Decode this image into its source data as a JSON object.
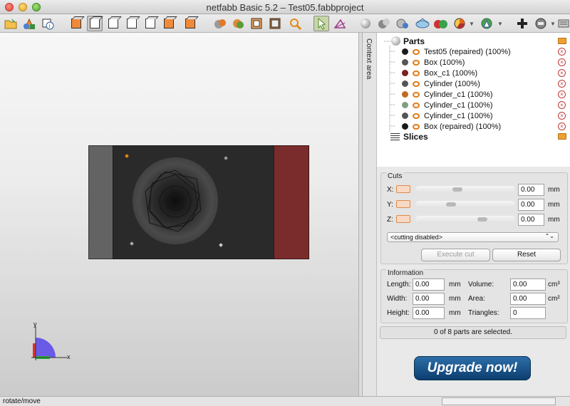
{
  "window": {
    "title": "netfabb Basic 5.2 – Test05.fabbproject"
  },
  "toolbar": {
    "icons": [
      "open-project-icon",
      "add-part-icon",
      "part-info-icon",
      "view-front-icon",
      "view-back-icon",
      "view-left-icon",
      "view-right-icon",
      "view-top-icon",
      "view-bottom-icon",
      "view-iso-icon",
      "shade-icon",
      "texture-icon",
      "frame-icon",
      "zoom-icon",
      "select-arrow-icon",
      "rotate-icon",
      "sphere-gray-icon",
      "sphere-dual-icon",
      "sphere-transparent-icon",
      "wireframe-icon",
      "color-spheres-icon",
      "pie-icon",
      "repair-icon",
      "add-icon",
      "settings-icon",
      "options-icon"
    ]
  },
  "viewport": {
    "axis_x": "x",
    "axis_y": "y"
  },
  "context_area": {
    "label": "Context area"
  },
  "tree": {
    "root": "Parts",
    "parts": [
      {
        "name": "Test05 (repaired) (100%)",
        "color": "#1a1a1a"
      },
      {
        "name": "Box (100%)",
        "color": "#555555"
      },
      {
        "name": "Box_c1 (100%)",
        "color": "#7a2020"
      },
      {
        "name": "Cylinder (100%)",
        "color": "#555555"
      },
      {
        "name": "Cylinder_c1 (100%)",
        "color": "#c06a20"
      },
      {
        "name": "Cylinder_c1 (100%)",
        "color": "#7fa080"
      },
      {
        "name": "Cylinder_c1 (100%)",
        "color": "#555555"
      },
      {
        "name": "Box (repaired) (100%)",
        "color": "#1a1a1a"
      }
    ],
    "slices": "Slices"
  },
  "cuts": {
    "title": "Cuts",
    "axes": [
      {
        "label": "X:",
        "value": "0.00",
        "unit": "mm",
        "knob_frac": 0.41
      },
      {
        "label": "Y:",
        "value": "0.00",
        "unit": "mm",
        "knob_frac": 0.34
      },
      {
        "label": "Z:",
        "value": "0.00",
        "unit": "mm",
        "knob_frac": 0.69
      }
    ],
    "mode": "<cutting disabled>",
    "execute": "Execute cut",
    "reset": "Reset"
  },
  "information": {
    "title": "Information",
    "length_label": "Length:",
    "length_value": "0.00",
    "length_unit": "mm",
    "width_label": "Width:",
    "width_value": "0.00",
    "width_unit": "mm",
    "height_label": "Height:",
    "height_value": "0.00",
    "height_unit": "mm",
    "volume_label": "Volume:",
    "volume_value": "0.00",
    "volume_unit": "cm³",
    "area_label": "Area:",
    "area_value": "0.00",
    "area_unit": "cm²",
    "triangles_label": "Triangles:",
    "triangles_value": "0"
  },
  "selection_status": "0 of 8 parts are selected.",
  "upgrade": "Upgrade now!",
  "statusbar": {
    "mode": "rotate/move"
  }
}
